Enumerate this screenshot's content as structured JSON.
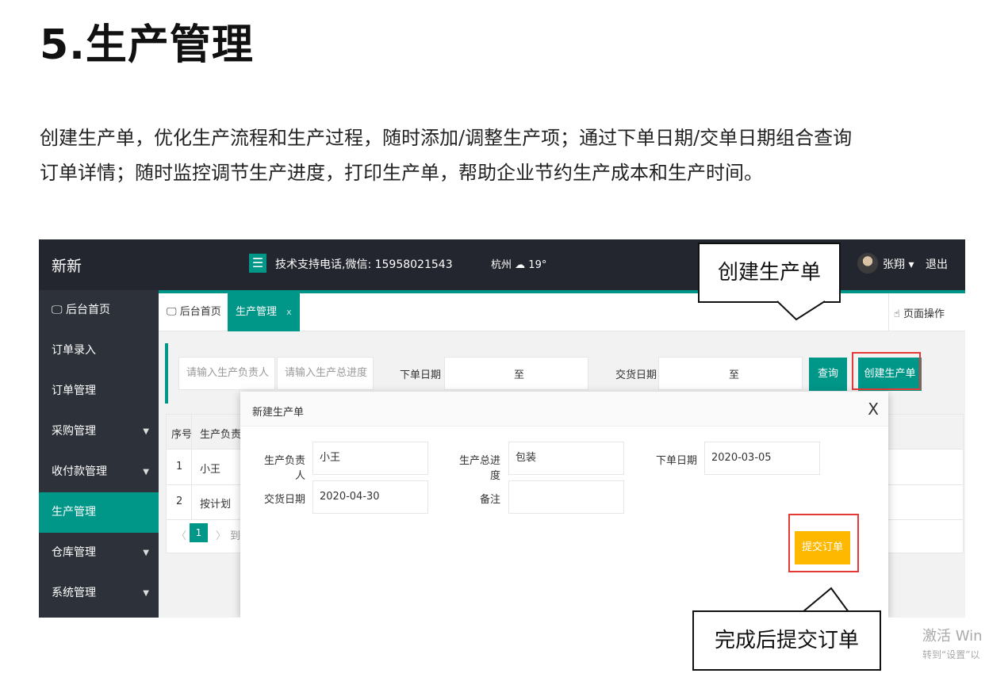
{
  "doc": {
    "title": "5.生产管理",
    "paragraph": "创建生产单，优化生产流程和生产过程，随时添加/调整生产项；通过下单日期/交单日期组合查询订单详情；随时监控调节生产进度，打印生产单，帮助企业节约生产成本和生产时间。"
  },
  "app": {
    "brand": "新新",
    "menu_icon": "menu-icon",
    "support_text": "技术支持电话,微信: 15958021543",
    "weather": {
      "city": "杭州",
      "icon": "cloud-icon",
      "temp": "19°"
    },
    "user": {
      "name": "张翔 ▾",
      "logout": "退出"
    }
  },
  "sidebar": {
    "items": [
      {
        "label": "后台首页",
        "icon": "monitor-icon"
      },
      {
        "label": "订单录入"
      },
      {
        "label": "订单管理"
      },
      {
        "label": "采购管理",
        "caret": "▼"
      },
      {
        "label": "收付款管理",
        "caret": "▼"
      },
      {
        "label": "生产管理",
        "active": true
      },
      {
        "label": "仓库管理",
        "caret": "▼"
      },
      {
        "label": "系统管理",
        "caret": "▼"
      }
    ]
  },
  "tabs": [
    {
      "label": "后台首页",
      "icon": "monitor-icon"
    },
    {
      "label": "生产管理",
      "close": "x",
      "active": true
    }
  ],
  "page_ops": "页面操作",
  "filter": {
    "owner_placeholder": "请输入生产负责人",
    "progress_placeholder": "请输入生产总进度",
    "order_date_label": "下单日期",
    "to_label_1": "至",
    "delivery_date_label": "交货日期",
    "to_label_2": "至",
    "query_button": "查询",
    "create_button": "创建生产单"
  },
  "table": {
    "columns": [
      "序号",
      "生产负责人"
    ],
    "rows": [
      {
        "index": "1",
        "owner": "小王"
      },
      {
        "index": "2",
        "owner": "按计划"
      }
    ],
    "pager": {
      "prev": "〈",
      "current": "1",
      "next": "〉",
      "goto": "到"
    }
  },
  "modal": {
    "title": "新建生产单",
    "close": "X",
    "fields": {
      "owner_label": "生产负责人",
      "owner_value": "小王",
      "progress_label": "生产总进度",
      "progress_value": "包装",
      "order_date_label": "下单日期",
      "order_date_value": "2020-03-05",
      "delivery_date_label": "交货日期",
      "delivery_date_value": "2020-04-30",
      "remark_label": "备注",
      "remark_value": ""
    },
    "submit_button": "提交订单"
  },
  "callouts": {
    "create": "创建生产单",
    "submit": "完成后提交订单"
  },
  "watermark": {
    "line1": "激活 Win",
    "line2": "转到“设置”以"
  }
}
